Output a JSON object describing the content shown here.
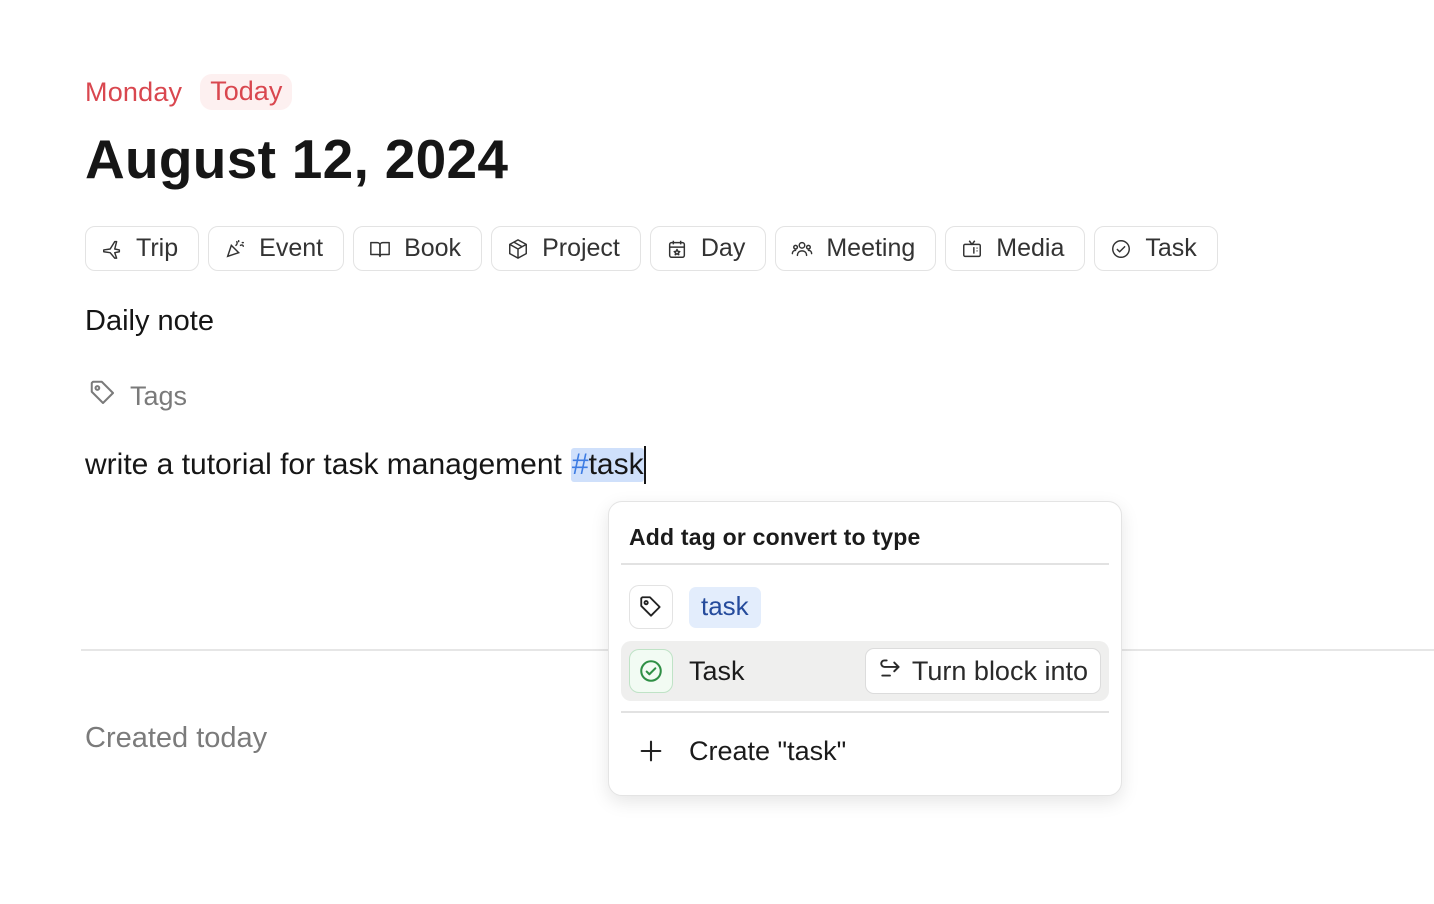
{
  "header": {
    "day_name": "Monday",
    "today_badge": "Today",
    "date_title": "August 12, 2024"
  },
  "types": [
    {
      "label": "Trip",
      "icon": "plane-icon"
    },
    {
      "label": "Event",
      "icon": "party-icon"
    },
    {
      "label": "Book",
      "icon": "book-icon"
    },
    {
      "label": "Project",
      "icon": "box-icon"
    },
    {
      "label": "Day",
      "icon": "calendar-icon"
    },
    {
      "label": "Meeting",
      "icon": "people-icon"
    },
    {
      "label": "Media",
      "icon": "tv-icon"
    },
    {
      "label": "Task",
      "icon": "check-circle-icon"
    }
  ],
  "note": {
    "section_title": "Daily note",
    "tags_label": "Tags",
    "line_text": "write a tutorial for task management",
    "hash_mark": "#",
    "hash_word": "task"
  },
  "footer": {
    "created_label": "Created today"
  },
  "popup": {
    "header": "Add tag or convert to type",
    "tag_option": "task",
    "type_option": "Task",
    "turn_into_label": "Turn block into",
    "create_option": "Create \"task\""
  },
  "colors": {
    "accent_red": "#d9474f",
    "tag_blue": "#3d7ce3",
    "task_green": "#2f8f45"
  }
}
